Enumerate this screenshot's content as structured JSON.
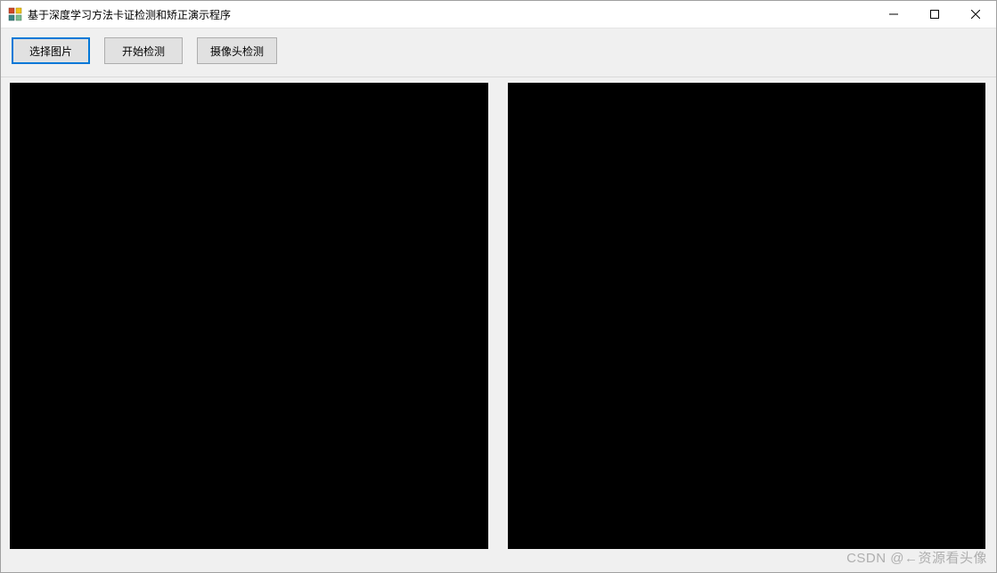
{
  "window": {
    "title": "基于深度学习方法卡证检测和矫正演示程序"
  },
  "toolbar": {
    "select_image_label": "选择图片",
    "start_detect_label": "开始检测",
    "camera_detect_label": "摄像头检测"
  },
  "panels": {
    "left": {
      "background": "#000000"
    },
    "right": {
      "background": "#000000"
    }
  },
  "watermark": "CSDN @←资源看头像"
}
